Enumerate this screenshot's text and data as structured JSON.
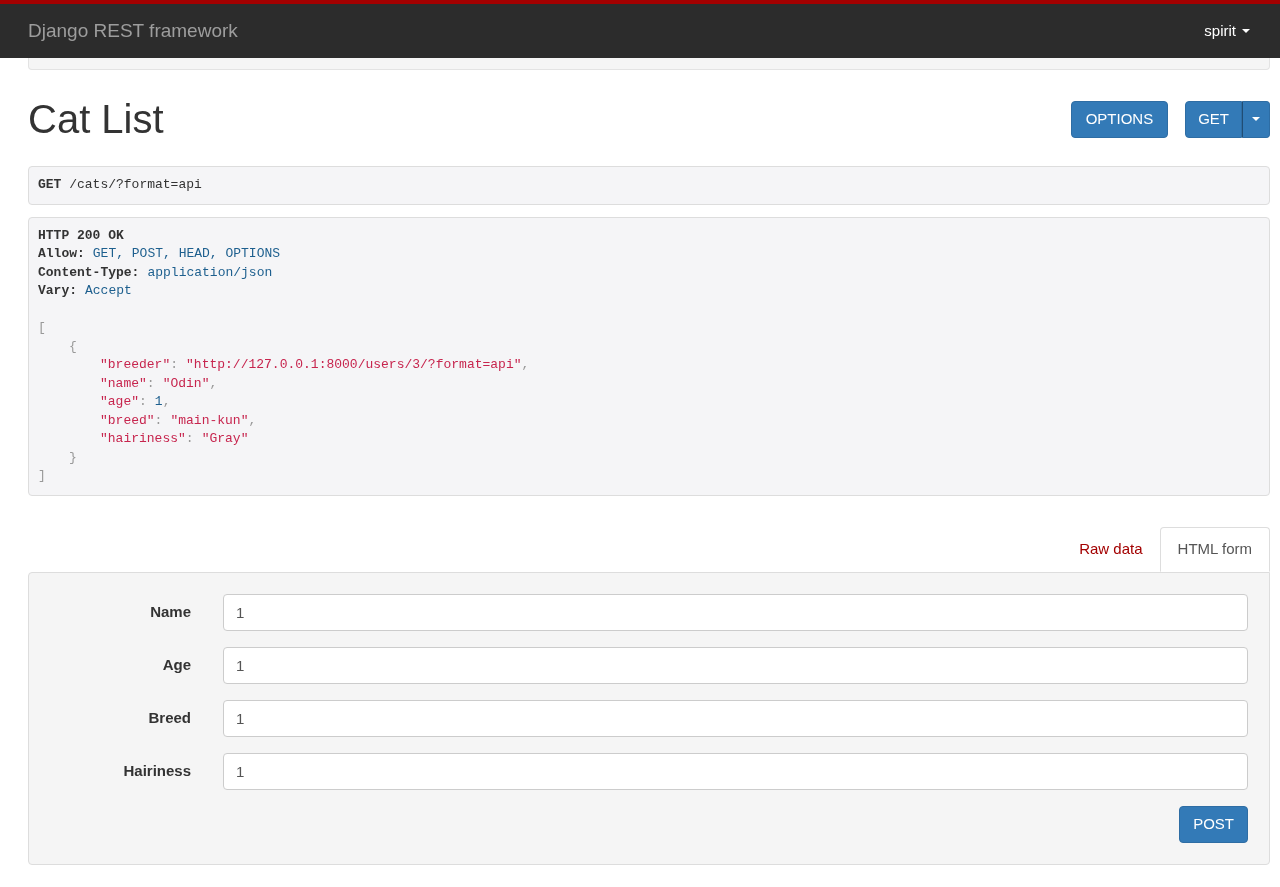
{
  "navbar": {
    "brand": "Django REST framework",
    "user": "spirit"
  },
  "title": "Cat List",
  "actions": [
    {
      "label": "OPTIONS",
      "kind": "plain"
    },
    {
      "label": "GET",
      "kind": "split"
    }
  ],
  "request": {
    "method": "GET",
    "path": "/cats/?format=api"
  },
  "response": {
    "status": "HTTP 200 OK",
    "headers": [
      {
        "key": "Allow:",
        "value": "GET, POST, HEAD, OPTIONS"
      },
      {
        "key": "Content-Type:",
        "value": "application/json"
      },
      {
        "key": "Vary:",
        "value": "Accept"
      }
    ],
    "body": {
      "open": "[",
      "close": "]",
      "items": [
        {
          "open": "{",
          "close": "}",
          "fields": [
            {
              "key": "\"breeder\"",
              "colon": ":",
              "value": "\"http://127.0.0.1:8000/users/3/?format=api\"",
              "kind": "string",
              "comma": ","
            },
            {
              "key": "\"name\"",
              "colon": ":",
              "value": "\"Odin\"",
              "kind": "string",
              "comma": ","
            },
            {
              "key": "\"age\"",
              "colon": ":",
              "value": "1",
              "kind": "number",
              "comma": ","
            },
            {
              "key": "\"breed\"",
              "colon": ":",
              "value": "\"main-kun\"",
              "kind": "string",
              "comma": ","
            },
            {
              "key": "\"hairiness\"",
              "colon": ":",
              "value": "\"Gray\"",
              "kind": "string"
            }
          ]
        }
      ]
    }
  },
  "tabs": [
    {
      "label": "Raw data",
      "selected": false
    },
    {
      "label": "HTML form",
      "selected": true
    }
  ],
  "form": {
    "fields": [
      {
        "label": "Name",
        "value": "1"
      },
      {
        "label": "Age",
        "value": "1"
      },
      {
        "label": "Breed",
        "value": "1"
      },
      {
        "label": "Hairiness",
        "value": "1"
      }
    ],
    "submit": "POST"
  }
}
